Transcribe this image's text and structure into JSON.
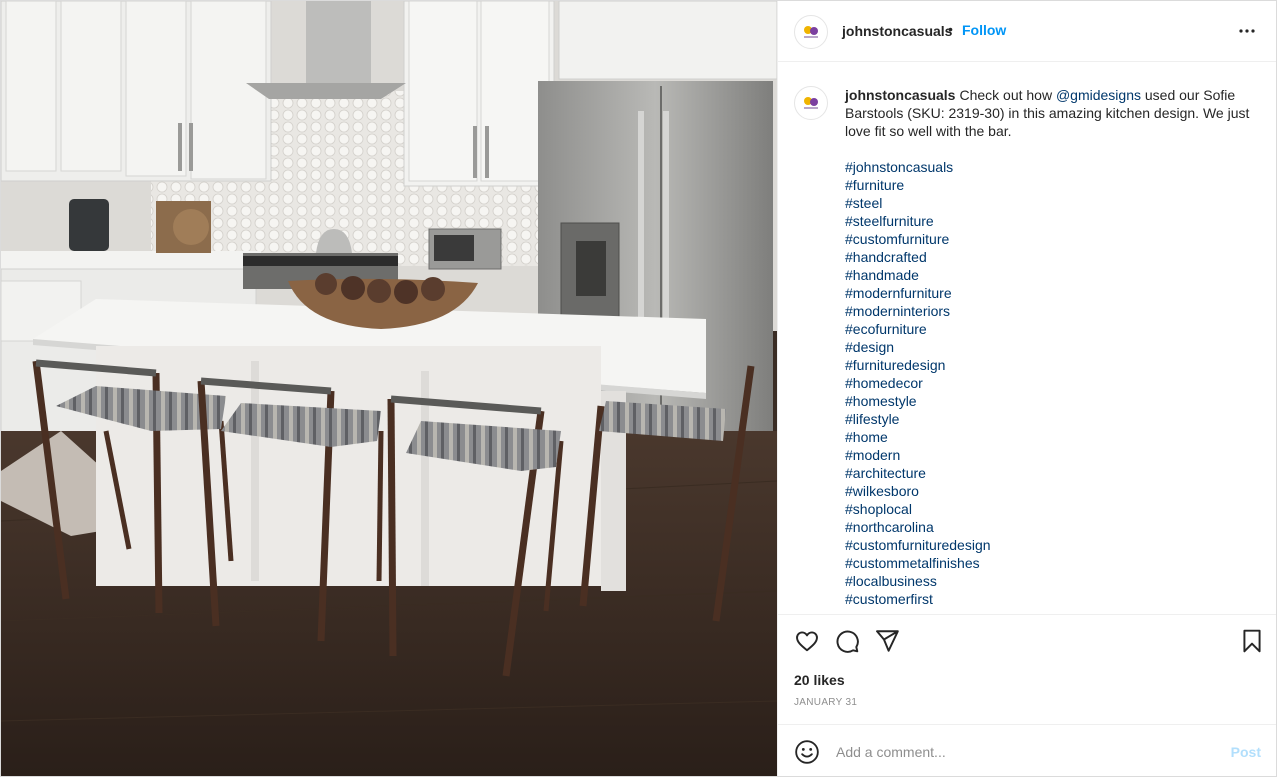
{
  "post": {
    "username": "johnstoncasuals",
    "follow_label": "Follow",
    "separator": "•",
    "more_icon": "more-horizontal-icon"
  },
  "caption": {
    "username": "johnstoncasuals",
    "text_before": "Check out how ",
    "mention": "@gmidesigns",
    "text_after": " used our Sofie Barstools (SKU: 2319-30) in this amazing kitchen design. We just love fit so well with the bar.",
    "hashtags": [
      "#johnstoncasuals",
      "#furniture",
      "#steel",
      "#steelfurniture",
      "#customfurniture",
      "#handcrafted",
      "#handmade",
      "#modernfurniture",
      "#moderninteriors",
      "#ecofurniture",
      "#design",
      "#furnituredesign",
      "#homedecor",
      "#homestyle",
      "#lifestyle",
      "#home",
      "#modern",
      "#architecture",
      "#wilkesboro",
      "#shoplocal",
      "#northcarolina",
      "#customfurnituredesign",
      "#custommetalfinishes",
      "#localbusiness",
      "#customerfirst"
    ]
  },
  "stats": {
    "likes": "20 likes",
    "date": "JANUARY 31"
  },
  "comment": {
    "placeholder": "Add a comment...",
    "post_label": "Post"
  },
  "colors": {
    "link_blue": "#0095f6",
    "hashtag": "#00376b",
    "post_disabled": "#b2dffc"
  }
}
